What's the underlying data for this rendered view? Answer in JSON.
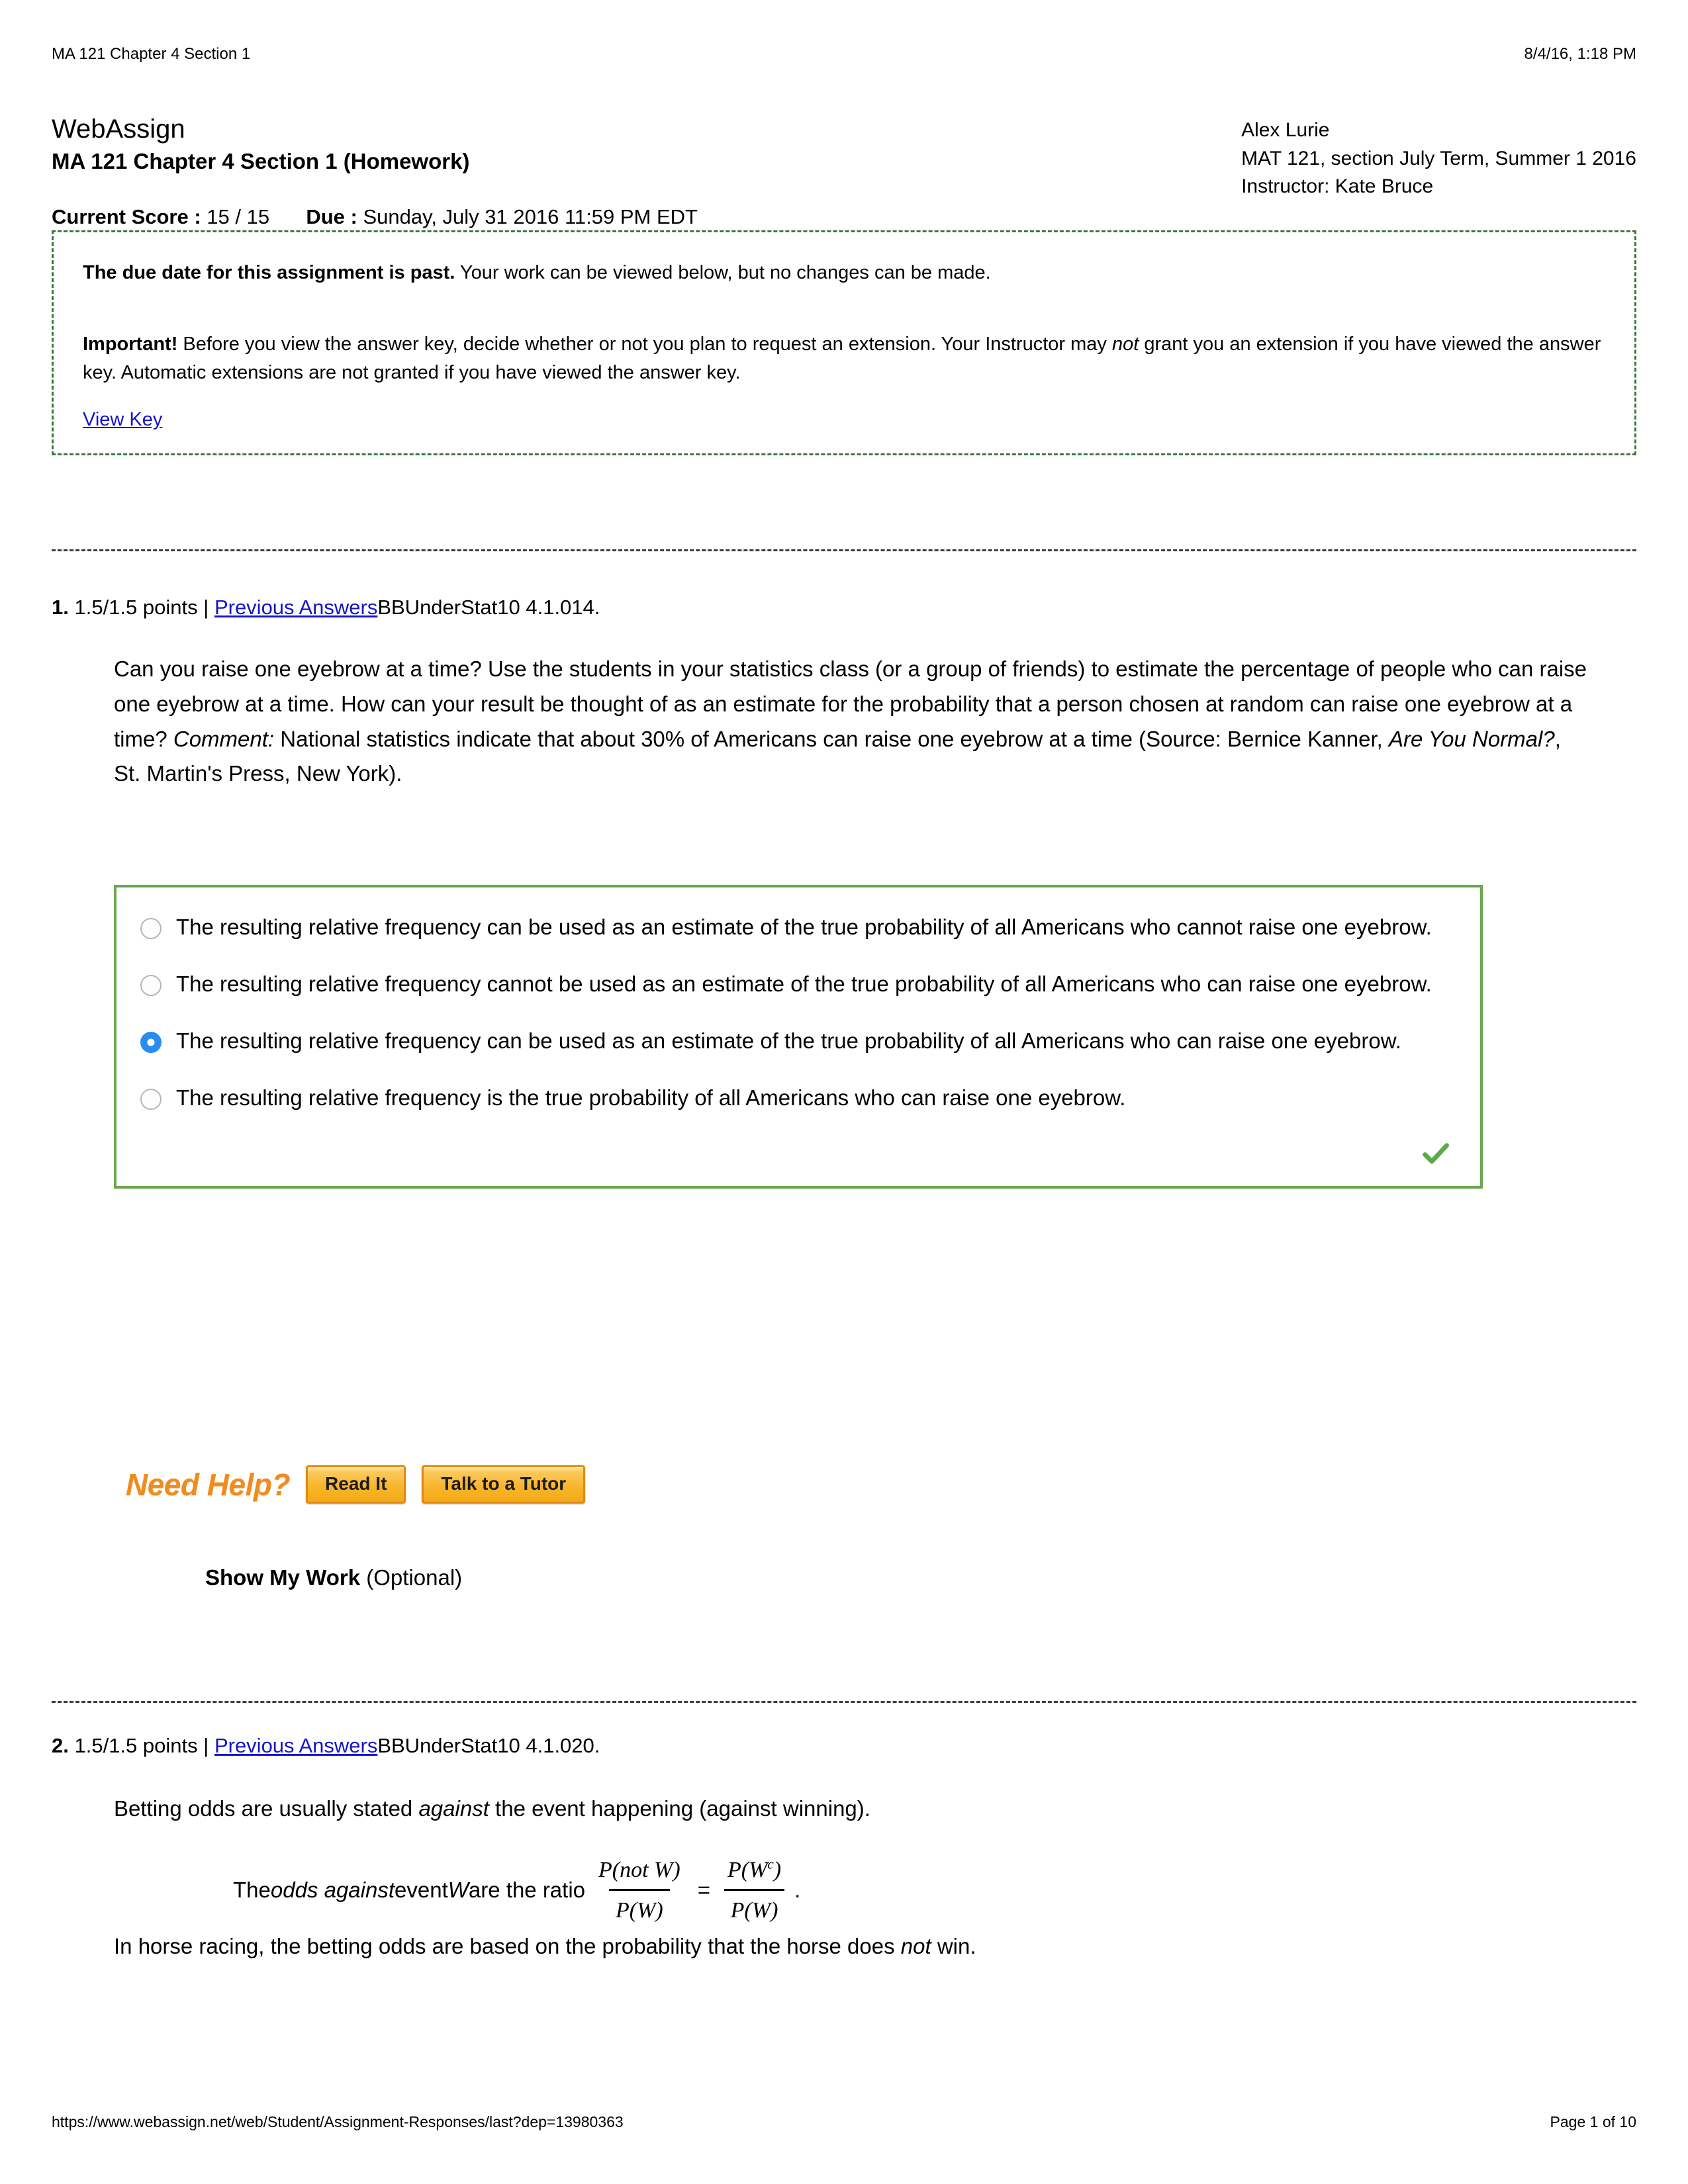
{
  "print_header": {
    "left": "MA 121 Chapter 4 Section 1",
    "right": "8/4/16, 1:18 PM"
  },
  "print_footer": {
    "url": "https://www.webassign.net/web/Student/Assignment-Responses/last?dep=13980363",
    "page": "Page 1 of 10"
  },
  "title": {
    "brand": "WebAssign",
    "assignment": "MA 121 Chapter 4 Section 1 (Homework)"
  },
  "student": {
    "name": "Alex Lurie",
    "course": "MAT 121, section July Term, Summer 1 2016",
    "instructor": "Instructor: Kate Bruce"
  },
  "score": {
    "current_label": "Current Score :",
    "current_value": "15 / 15",
    "due_label": "Due :",
    "due_value": "Sunday, July 31 2016 11:59 PM EDT"
  },
  "notice": {
    "past_due_bold": "The due date for this assignment is past.",
    "past_due_rest": " Your work can be viewed below, but no changes can be made.",
    "important_bold": "Important!",
    "important_part1": " Before you view the answer key, decide whether or not you plan to request an extension. Your Instructor may ",
    "important_italic": "not",
    "important_part2": " grant you an extension if you have viewed the answer key. Automatic extensions are not granted if you have viewed the answer key.",
    "view_key": "View Key"
  },
  "questions": [
    {
      "number": "1.",
      "points": "1.5/1.5 points",
      "separator": "|",
      "previous_answers": "Previous Answers",
      "textbook_code": "BBUnderStat10 4.1.014.",
      "prompt_part1": "Can you raise one eyebrow at a time? Use the students in your statistics class (or a group of friends) to estimate the percentage of people who can raise one eyebrow at a time. How can your result be thought of as an estimate for the probability that a person chosen at random can raise one eyebrow at a time? ",
      "prompt_italic1": "Comment:",
      "prompt_part2": " National statistics indicate that about 30% of Americans can raise one eyebrow at a time (Source: Bernice Kanner, ",
      "prompt_italic2": "Are You Normal?",
      "prompt_part3": ", St. Martin's Press, New York).",
      "choices": [
        {
          "label": "The resulting relative frequency can be used as an estimate of the true probability of all Americans who cannot raise one eyebrow.",
          "selected": false
        },
        {
          "label": "The resulting relative frequency cannot be used as an estimate of the true probability of all Americans who can raise one eyebrow.",
          "selected": false
        },
        {
          "label": "The resulting relative frequency can be used as an estimate of the true probability of all Americans who can raise one eyebrow.",
          "selected": true
        },
        {
          "label": "The resulting relative frequency is the true probability of all Americans who can raise one eyebrow.",
          "selected": false
        }
      ],
      "correct_mark": "green-checkmark",
      "need_help_label": "Need Help?",
      "need_help_buttons": [
        "Read It",
        "Talk to a Tutor"
      ],
      "show_my_work_bold": "Show My Work",
      "show_my_work_rest": " (Optional)"
    },
    {
      "number": "2.",
      "points": "1.5/1.5 points",
      "separator": "|",
      "previous_answers": "Previous Answers",
      "textbook_code": "BBUnderStat10 4.1.020.",
      "line1_part1": "Betting odds are usually stated ",
      "line1_italic": "against",
      "line1_part2": " the event happening (against winning).",
      "ratio_part1": "The ",
      "ratio_italic1": "odds against",
      "ratio_part2": " event ",
      "ratio_italic2": "W",
      "ratio_part3": " are the ratio",
      "frac1_num": "P(not W)",
      "frac1_den": "P(W)",
      "equals": "=",
      "frac2_num_pre": "P(W",
      "frac2_num_sup": "c",
      "frac2_num_post": ")",
      "frac2_den": "P(W)",
      "ratio_period": ".",
      "line3_part1": "In horse racing, the betting odds are based on the probability that the horse does ",
      "line3_italic": "not",
      "line3_part2": " win."
    }
  ],
  "colors": {
    "link": "#1414cc",
    "notice_border": "#3a7a3a",
    "choices_border": "#6aa84f",
    "radio_selected": "#2a8cf0",
    "checkmark": "#5aaa46",
    "need_help_text": "#f08c1e",
    "button_face": "#f8b62c"
  }
}
